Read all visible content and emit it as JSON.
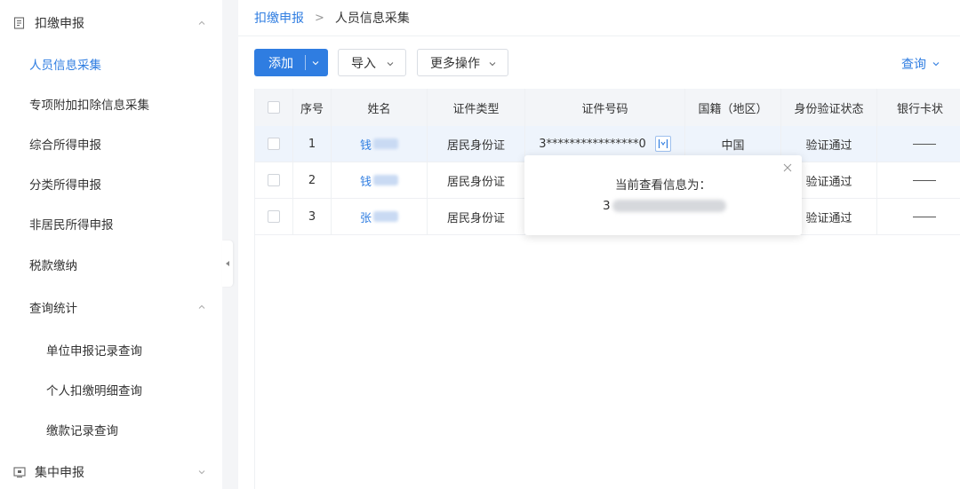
{
  "sidebar": {
    "group1": {
      "label": "扣缴申报",
      "icon": "document-icon"
    },
    "items": [
      {
        "label": "人员信息采集",
        "active": true
      },
      {
        "label": "专项附加扣除信息采集"
      },
      {
        "label": "综合所得申报"
      },
      {
        "label": "分类所得申报"
      },
      {
        "label": "非居民所得申报"
      },
      {
        "label": "税款缴纳"
      },
      {
        "label": "查询统计"
      }
    ],
    "sub_items": [
      {
        "label": "单位申报记录查询"
      },
      {
        "label": "个人扣缴明细查询"
      },
      {
        "label": "缴款记录查询"
      }
    ],
    "group2": {
      "label": "集中申报",
      "icon": "screen-icon"
    }
  },
  "breadcrumb": {
    "parent": "扣缴申报",
    "separator": ">",
    "current": "人员信息采集"
  },
  "toolbar": {
    "add_label": "添加",
    "import_label": "导入",
    "more_label": "更多操作",
    "query_label": "查询"
  },
  "table": {
    "headers": [
      "序号",
      "姓名",
      "证件类型",
      "证件号码",
      "国籍（地区）",
      "身份验证状态",
      "银行卡状"
    ],
    "rows": [
      {
        "no": "1",
        "name": "钱",
        "id_type": "居民身份证",
        "id_no": "3****************0",
        "nationality": "中国",
        "verify": "验证通过",
        "bank": ""
      },
      {
        "no": "2",
        "name": "钱",
        "id_type": "居民身份证",
        "id_no": "",
        "nationality": "",
        "verify": "验证通过",
        "bank": ""
      },
      {
        "no": "3",
        "name": "张",
        "id_type": "居民身份证",
        "id_no": "",
        "nationality": "",
        "verify": "验证通过",
        "bank": ""
      }
    ]
  },
  "popover": {
    "title": "当前查看信息为：",
    "value_prefix": "3"
  },
  "colors": {
    "accent": "#2f7de1",
    "row_highlight": "#eef4fc",
    "header_bg": "#f3f5f8"
  }
}
